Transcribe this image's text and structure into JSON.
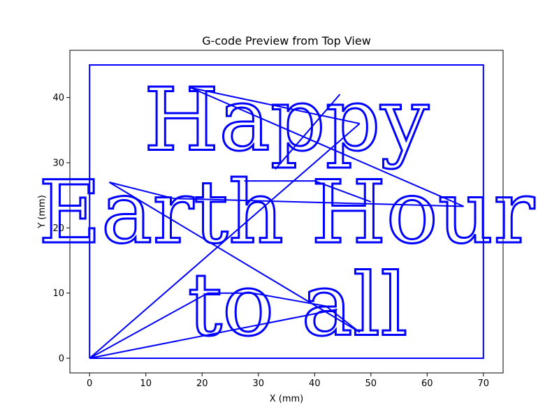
{
  "chart_data": {
    "type": "line",
    "title": "G-code Preview from Top View",
    "xlabel": "X (mm)",
    "ylabel": "Y (mm)",
    "xlim": [
      -3.5,
      73.5
    ],
    "ylim": [
      -2.25,
      47.25
    ],
    "xticks": [
      0,
      10,
      20,
      30,
      40,
      50,
      60,
      70
    ],
    "yticks": [
      0,
      10,
      20,
      30,
      40
    ],
    "grid": false,
    "series": [
      {
        "color": "#0000ff",
        "segments": [
          {
            "role": "border",
            "points": [
              [
                0,
                0
              ],
              [
                70,
                0
              ],
              [
                70,
                45
              ],
              [
                0,
                45
              ],
              [
                0,
                0
              ]
            ]
          },
          {
            "role": "travel",
            "points": [
              [
                0,
                0
              ],
              [
                48,
                36
              ]
            ]
          },
          {
            "role": "travel",
            "points": [
              [
                48,
                36
              ],
              [
                18,
                41.5
              ]
            ]
          },
          {
            "role": "travel",
            "points": [
              [
                18,
                41.5
              ],
              [
                66.5,
                23.3
              ]
            ]
          },
          {
            "role": "travel",
            "points": [
              [
                66.5,
                23.3
              ],
              [
                15,
                24.5
              ]
            ]
          },
          {
            "role": "travel",
            "points": [
              [
                15,
                24.5
              ],
              [
                3.5,
                27
              ]
            ]
          },
          {
            "role": "travel",
            "points": [
              [
                3.5,
                27
              ],
              [
                48,
                4
              ]
            ]
          },
          {
            "role": "travel",
            "points": [
              [
                48,
                4
              ],
              [
                42,
                8
              ]
            ]
          },
          {
            "role": "travel",
            "points": [
              [
                42,
                8
              ],
              [
                29,
                10
              ]
            ]
          },
          {
            "role": "travel",
            "points": [
              [
                29,
                10
              ],
              [
                21,
                10
              ]
            ]
          },
          {
            "role": "travel",
            "points": [
              [
                21,
                10
              ],
              [
                0,
                0
              ]
            ]
          },
          {
            "role": "travel",
            "points": [
              [
                0,
                0
              ],
              [
                44,
                7.5
              ]
            ]
          },
          {
            "role": "travel",
            "points": [
              [
                27.5,
                27.2
              ],
              [
                40,
                27.2
              ]
            ]
          },
          {
            "role": "travel",
            "points": [
              [
                40,
                27.2
              ],
              [
                50,
                24
              ]
            ]
          },
          {
            "role": "travel",
            "points": [
              [
                33,
                29
              ],
              [
                44.5,
                40.5
              ]
            ]
          }
        ],
        "text_toolpaths": [
          {
            "text": "Happy",
            "x_center": 35,
            "baseline": 32
          },
          {
            "text": "Earth Hour",
            "x_center": 35,
            "baseline": 17.8
          },
          {
            "text": "to all",
            "x_center": 37,
            "baseline": 3.6
          }
        ]
      }
    ]
  }
}
